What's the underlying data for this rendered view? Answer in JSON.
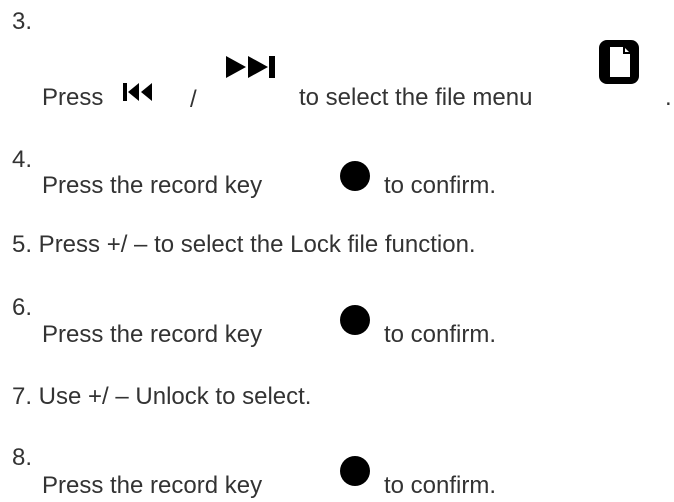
{
  "steps": [
    {
      "number": "3.",
      "text_before": "Press",
      "separator": "/",
      "text_after": "to select the file menu",
      "trailing": "."
    },
    {
      "number": "4.",
      "text_before": "Press the record key",
      "text_after": "to confirm."
    },
    {
      "text": "5. Press +/ – to select the Lock file function."
    },
    {
      "number": "6.",
      "text_before": "Press the record key",
      "text_after": "to confirm."
    },
    {
      "text": "7. Use +/ – Unlock to select."
    },
    {
      "number": "8.",
      "text_before": "Press the record key",
      "text_after": "to confirm."
    }
  ],
  "icons": {
    "skip_back": "skip-back-icon",
    "skip_forward": "skip-forward-icon",
    "file_menu": "file-menu-icon",
    "record_key": "record-key-icon"
  }
}
